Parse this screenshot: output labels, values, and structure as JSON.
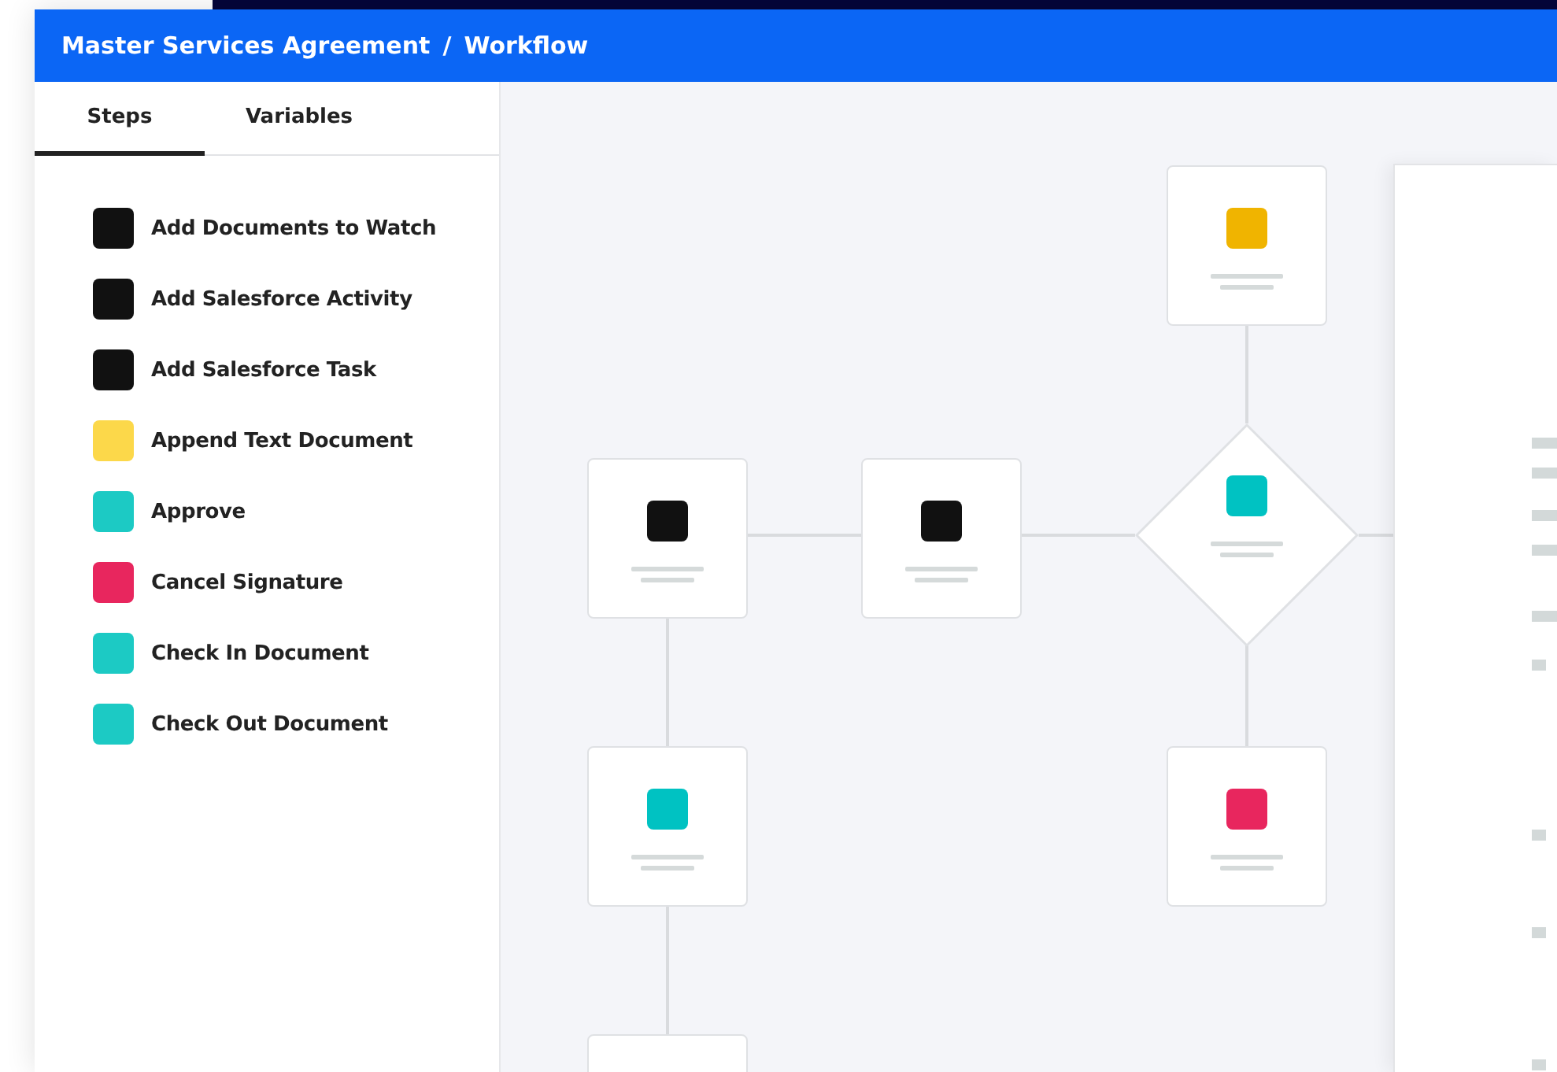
{
  "header": {
    "breadcrumb": [
      "Master Services Agreement",
      "Workflow"
    ],
    "separator": "/"
  },
  "sidebar": {
    "tabs": [
      {
        "label": "Steps",
        "selected": true
      },
      {
        "label": "Variables",
        "selected": false
      }
    ],
    "steps": [
      {
        "label": "Add Documents to Watch",
        "color": "#111111"
      },
      {
        "label": "Add Salesforce Activity",
        "color": "#111111"
      },
      {
        "label": "Add Salesforce Task",
        "color": "#111111"
      },
      {
        "label": "Append Text Document",
        "color": "#fcd84a"
      },
      {
        "label": "Approve",
        "color": "#1ccac4"
      },
      {
        "label": "Cancel Signature",
        "color": "#e8265e"
      },
      {
        "label": "Check In Document",
        "color": "#1ccac4"
      },
      {
        "label": "Check Out Document",
        "color": "#1ccac4"
      }
    ]
  },
  "canvas": {
    "nodes": [
      {
        "kind": "task",
        "color": "#f0b400"
      },
      {
        "kind": "task",
        "color": "#111111"
      },
      {
        "kind": "task",
        "color": "#111111"
      },
      {
        "kind": "decision",
        "color": "#00c2c2"
      },
      {
        "kind": "task",
        "color": "#00c2c2"
      },
      {
        "kind": "task",
        "color": "#e8265e"
      },
      {
        "kind": "task"
      }
    ]
  }
}
